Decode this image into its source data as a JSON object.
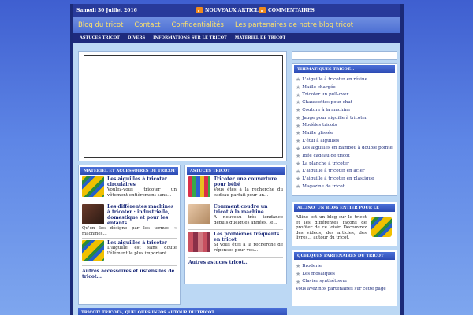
{
  "topbar": {
    "date": "Samedi 30 Juillet 2016",
    "rss1": "NOUVEAUX ARTICLES",
    "rss2": "COMMENTAIRES"
  },
  "nav1": [
    "Blog du tricot",
    "Contact",
    "Confidentialités",
    "Les partenaires de notre blog tricot"
  ],
  "nav2": [
    "ASTUCES TRICOT",
    "DIVERS",
    "INFORMATIONS SUR LE TRICOT",
    "MATÉRIEL DE TRICOT"
  ],
  "box_materiel": {
    "title": "MATERIEL ET ACCESSOIRES DE TRICOT",
    "items": [
      {
        "title": "Les aiguilles à tricoter circulaires",
        "desc": "Voulez-vous tricoter un vêtement entièrement sans..."
      },
      {
        "title": "Les différentes machines à tricoter : industrielle, domestique et pour les enfants",
        "desc": "Qu'on les désigne par les termes « machines..."
      },
      {
        "title": "Les aiguilles à tricoter",
        "desc": "L'aiguille est sans doute l'élément le plus important..."
      }
    ],
    "more": "Autres accessoires et ustensiles de tricot..."
  },
  "box_astuces": {
    "title": "ASTUCES TRICOT",
    "items": [
      {
        "title": "Tricoter une couverture pour bébé",
        "desc": "Vous êtes à la recherche du cadeau parfait pour un..."
      },
      {
        "title": "Comment coudre un tricot à la machine",
        "desc": "A nouveau très tendance depuis quelques années, le..."
      },
      {
        "title": "Les problèmes fréquents en tricot",
        "desc": "Si vous êtes à la recherche de réponses pour vos..."
      }
    ],
    "more": "Autres astuces tricot..."
  },
  "bottom_bar": "TRICOT! TRICOTA, QUELQUES INFOS AUTOUR DU TRICOT...",
  "side_themes": {
    "title": "THEMATIQUES TRICOT...",
    "items": [
      "L'aiguille à tricoter en résine",
      "Maille chargée",
      "Tricoter un pull-over",
      "Chaussettes pour chat",
      "Couture à la machine",
      "Jauge pour aiguille à tricoter",
      "Modèles tricots",
      "Maille glissée",
      "L'étui à aiguilles",
      "Les aiguilles en bambou à double pointe",
      "Idée cadeau de tricot",
      "La planche à tricoter",
      "L'aiguille à tricoter en acier",
      "L'aiguille à tricoter en plastique",
      "Magazine de tricot"
    ]
  },
  "side_allino": {
    "title": "ALLINO, UN BLOG ENTIER POUR LE TRICOT!",
    "text": "Allino est un blog sur le tricot et les différentes façons de profiter de ce loisir. Découvrez des vidéos, des articles, des livres... autour du tricot."
  },
  "side_partners": {
    "title": "QUELQUES PARTENAIRES DU TRICOT",
    "items": [
      "Broderie",
      "Les mosaïques",
      "Clavier synthétiseur"
    ],
    "more": "Vous avez nos partenaires sur cette page"
  },
  "colors": {
    "accent": "#2c4ab3",
    "nav_text": "#ffe36a",
    "link": "#1b2a78"
  }
}
